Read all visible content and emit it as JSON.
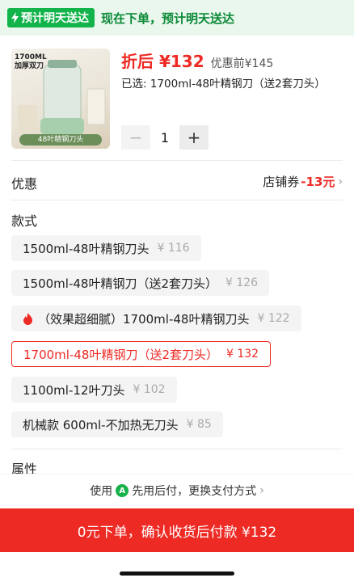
{
  "delivery": {
    "badge": "预计明天送达",
    "text": "现在下单，预计明天送达"
  },
  "product": {
    "image_capacity": "1700ML\n加厚双刀",
    "image_caption": "48叶精钢刀头",
    "price": "折后 ¥132",
    "original_price": "优惠前¥145",
    "selected": "已选: 1700ml-48叶精钢刀（送2套刀头）",
    "quantity": "1",
    "minus": "−",
    "plus": "+"
  },
  "discount": {
    "label": "优惠",
    "coupon_label": "店铺券",
    "coupon_value": "-13元"
  },
  "style": {
    "label": "款式",
    "options": [
      {
        "name": "1500ml-48叶精钢刀头",
        "price": "¥ 116"
      },
      {
        "name": "1500ml-48叶精钢刀（送2套刀头）",
        "price": "¥ 126"
      },
      {
        "name": "（效果超细腻）1700ml-48叶精钢刀头",
        "price": "¥ 122"
      },
      {
        "name": "1700ml-48叶精钢刀（送2套刀头）",
        "price": "¥ 132"
      },
      {
        "name": "1100ml-12叶刀头",
        "price": "¥ 102"
      },
      {
        "name": "机械款 600ml-不加热无刀头",
        "price": "¥ 85"
      }
    ]
  },
  "attributes": {
    "label": "属性"
  },
  "payment": {
    "prefix": "使用",
    "icon_letter": "A",
    "text": "先用后付，更换支付方式"
  },
  "confirm": {
    "label": "0元下单，确认收货后付款 ¥132"
  },
  "colors": {
    "accent_red": "#ee2a24",
    "delivery_green": "#12b34a"
  },
  "icons": [
    "bolt-icon",
    "fire-icon",
    "chevron-right-icon",
    "pay-later-icon"
  ]
}
